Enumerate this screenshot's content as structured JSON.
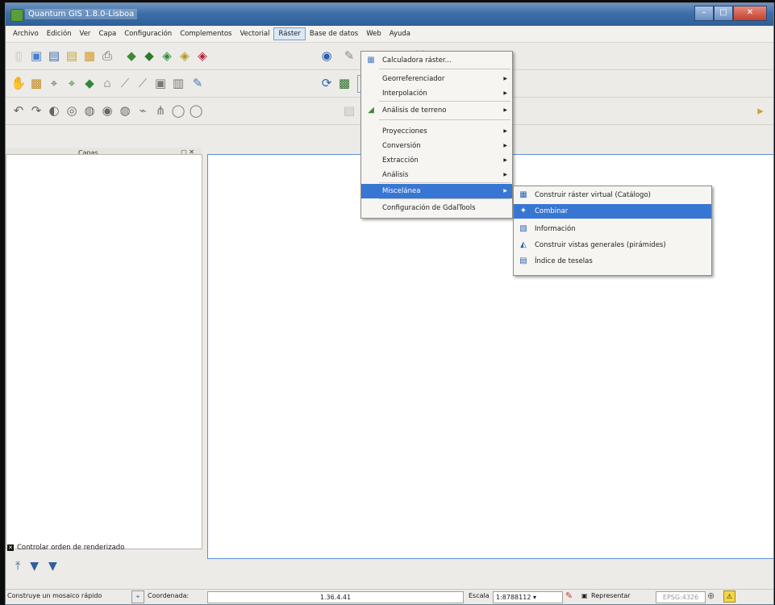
{
  "window": {
    "title": "Quantum GIS 1.8.0-Lisboa"
  },
  "menubar": [
    "Archivo",
    "Edición",
    "Ver",
    "Capa",
    "Configuración",
    "Complementos",
    "Vectorial",
    "Ráster",
    "Base de datos",
    "Web",
    "Ayuda"
  ],
  "active_menu": "Ráster",
  "raster_menu": [
    {
      "label": "Calculadora ráster...",
      "submenu": false
    },
    {
      "label": "Georreferenciador",
      "submenu": true
    },
    {
      "label": "Interpolación",
      "submenu": true
    },
    {
      "label": "Análisis de terreno",
      "submenu": true
    },
    {
      "label": "Proyecciones",
      "submenu": true
    },
    {
      "label": "Conversión",
      "submenu": true
    },
    {
      "label": "Extracción",
      "submenu": true
    },
    {
      "label": "Análisis",
      "submenu": true
    },
    {
      "label": "Miscelánea",
      "submenu": true,
      "selected": true
    },
    {
      "label": "Configuración de GdalTools",
      "submenu": false
    }
  ],
  "misc_submenu": [
    {
      "label": "Construir ráster virtual (Catálogo)"
    },
    {
      "label": "Combinar",
      "selected": true
    },
    {
      "label": "Información"
    },
    {
      "label": "Construir vistas generales (pirámides)"
    },
    {
      "label": "Índice de teselas"
    }
  ],
  "layers_panel": {
    "title": "Capas",
    "buttons": "▢ ✕"
  },
  "render_order": {
    "label": "Controlar orden de renderizado",
    "checked": true
  },
  "statusbar": {
    "message": "Construye un mosaico rápido",
    "coord_label": "Coordenada:",
    "coord_value": "1.36.4.41",
    "scale_label": "Escala",
    "scale_value": "1:8788112",
    "render_label": "Representar",
    "crs": "EPSG:4326"
  },
  "colors": {
    "accent": "#3876d3",
    "canvas_border": "#5d8fd1"
  }
}
